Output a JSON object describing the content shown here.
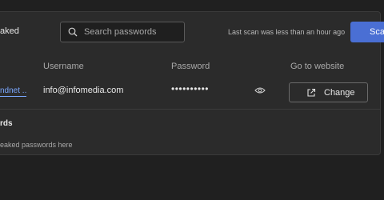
{
  "header": {
    "title": "aked",
    "search_placeholder": "Search passwords",
    "last_scan": "Last scan was less than an hour ago",
    "scan_button": "Scan"
  },
  "table": {
    "columns": [
      "Username",
      "Password",
      "Go to website"
    ],
    "row": {
      "site": "ndnet ..",
      "username": "info@infomedia.com",
      "password": "••••••••••",
      "change_label": "Change"
    }
  },
  "section": {
    "title": "rds",
    "empty_text": "eaked passwords here"
  },
  "colors": {
    "background": "#202020",
    "card": "#2b2b2b",
    "accent": "#4a6fd4",
    "link": "#7aa7ff"
  },
  "icons": [
    "search-icon",
    "eye-icon",
    "external-link-icon"
  ]
}
